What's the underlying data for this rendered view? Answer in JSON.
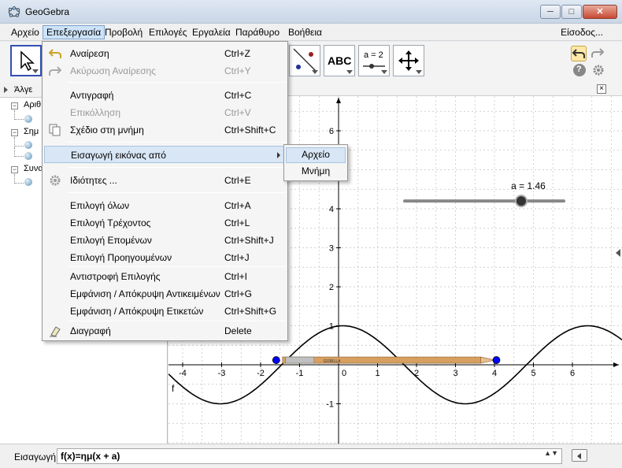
{
  "window": {
    "title": "GeoGebra",
    "minimize": "─",
    "maximize": "□",
    "close": "✕"
  },
  "menubar": {
    "items": [
      "Αρχείο",
      "Επεξεργασία",
      "Προβολή",
      "Επιλογές",
      "Εργαλεία",
      "Παράθυρο",
      "Βοήθεια"
    ],
    "login": "Είσοδος..."
  },
  "toolbar": {
    "tools": [
      {
        "name": "move-tool",
        "icon": "arrow-cursor-icon"
      },
      {
        "name": "reflect-tool",
        "icon": "reflect-line-icon"
      },
      {
        "name": "text-tool",
        "icon": "text-abc-icon",
        "label": "ABC"
      },
      {
        "name": "slider-tool",
        "icon": "slider-icon",
        "label": "a = 2"
      },
      {
        "name": "move-view-tool",
        "icon": "move-arrows-icon"
      }
    ]
  },
  "algebra": {
    "header": "Άλγε",
    "categories": [
      "Αριθ",
      "Σημ",
      "Συνα"
    ]
  },
  "edit_menu": {
    "items": [
      {
        "label": "Αναίρεση",
        "shortcut": "Ctrl+Z",
        "icon": "undo-icon"
      },
      {
        "label": "Ακύρωση Αναίρεσης",
        "shortcut": "Ctrl+Y",
        "icon": "redo-icon",
        "disabled": true
      },
      {
        "label": "Αντιγραφή",
        "shortcut": "Ctrl+C"
      },
      {
        "label": "Επικόλληση",
        "shortcut": "Ctrl+V",
        "disabled": true
      },
      {
        "label": "Σχέδιο στη μνήμη",
        "shortcut": "Ctrl+Shift+C",
        "icon": "copy-graphics-icon"
      },
      {
        "label": "Εισαγωγή εικόνας από",
        "shortcut": "",
        "submenu": true
      },
      {
        "label": "Ιδιότητες ...",
        "shortcut": "Ctrl+E",
        "icon": "properties-gear-icon"
      },
      {
        "label": "Επιλογή όλων",
        "shortcut": "Ctrl+A"
      },
      {
        "label": "Επιλογή Τρέχοντος",
        "shortcut": "Ctrl+L"
      },
      {
        "label": "Επιλογή Επομένων",
        "shortcut": "Ctrl+Shift+J"
      },
      {
        "label": "Επιλογή Προηγουμένων",
        "shortcut": "Ctrl+J"
      },
      {
        "label": "Αντιστροφή Επιλογής",
        "shortcut": "Ctrl+I"
      },
      {
        "label": "Εμφάνιση / Απόκρυψη Αντικειμένων",
        "shortcut": "Ctrl+G"
      },
      {
        "label": "Εμφάνιση / Απόκρυψη Ετικετών",
        "shortcut": "Ctrl+Shift+G"
      },
      {
        "label": "Διαγραφή",
        "shortcut": "Delete",
        "icon": "eraser-icon"
      }
    ],
    "submenu": [
      "Αρχείο",
      "Μνήμη"
    ]
  },
  "graphics": {
    "x_ticks": [
      "-4",
      "-3",
      "-2",
      "-1",
      "0",
      "1",
      "2",
      "3",
      "4",
      "5",
      "6"
    ],
    "y_ticks": [
      "6",
      "5",
      "4",
      "3",
      "2",
      "1",
      "-1"
    ],
    "slider_label": "a = 1.46",
    "slider_value": 1.46,
    "function_label": "f",
    "image_text": "GORILLA",
    "colors": {
      "curve": "#000000",
      "slider": "#333333",
      "points": "#0000ff",
      "grid": "#c0c0c0"
    }
  },
  "input_bar": {
    "label": "Εισαγωγή:",
    "value": "f(x)=ημ(x + a)",
    "spinner": "▲▼"
  }
}
